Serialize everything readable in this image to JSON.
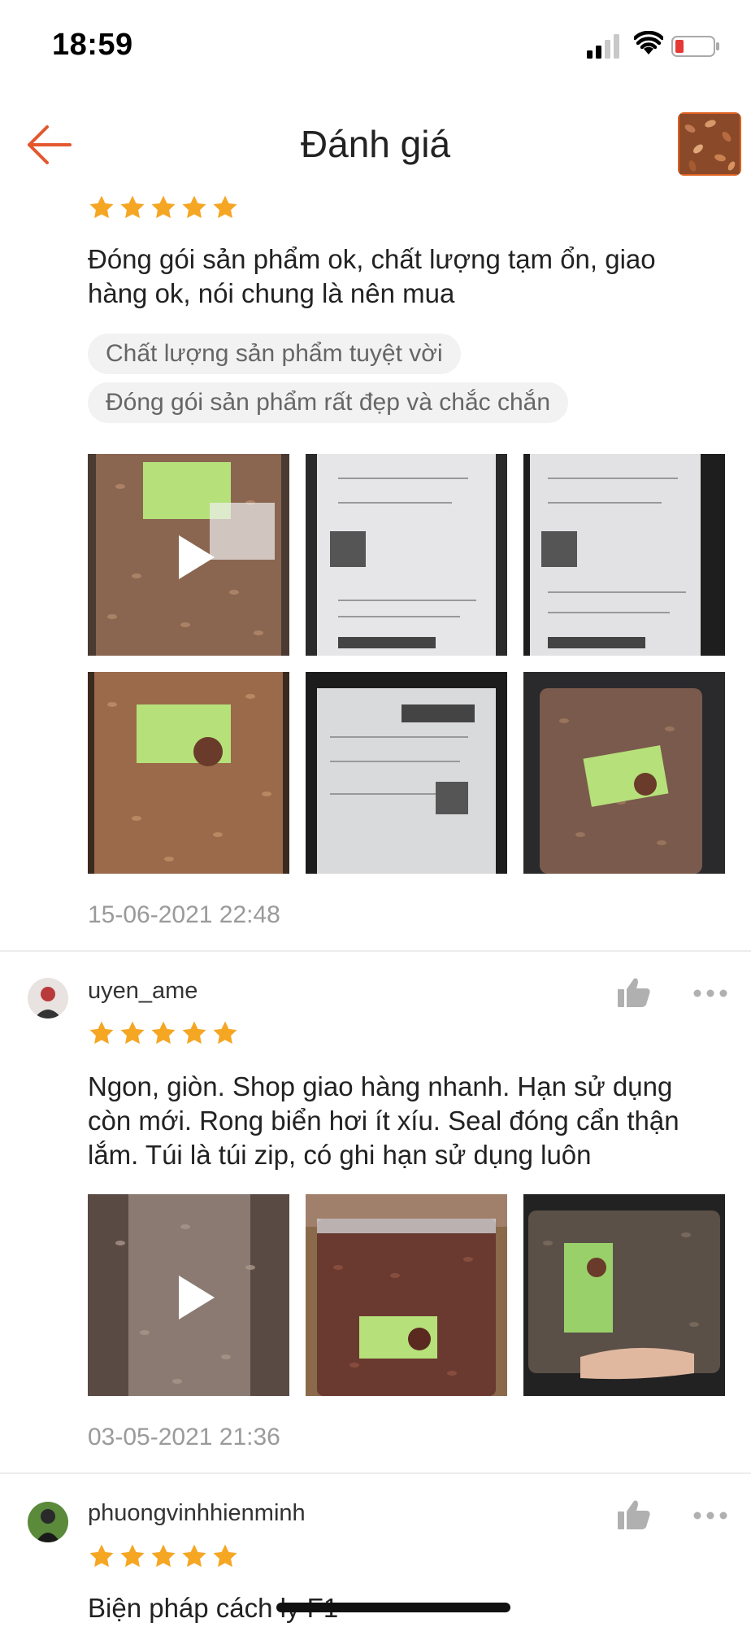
{
  "status_bar": {
    "time": "18:59"
  },
  "header": {
    "title": "Đánh giá"
  },
  "reviews": [
    {
      "rating": 5,
      "text": "Đóng gói sản phẩm ok, chất lượng tạm ổn, giao hàng ok, nói chung là nên mua",
      "tags": [
        "Chất lượng sản phẩm tuyệt vời",
        "Đóng gói sản phẩm rất đẹp và chắc chắn"
      ],
      "date": "15-06-2021 22:48"
    },
    {
      "username": "uyen_ame",
      "rating": 5,
      "text": "Ngon, giòn. Shop giao hàng nhanh. Hạn sử dụng còn mới. Rong biển hơi ít xíu. Seal đóng cẩn thận lắm. Túi là túi zip, có ghi hạn sử dụng luôn",
      "date": "03-05-2021 21:36"
    },
    {
      "username": "phuongvinhhienminh",
      "rating": 5,
      "text": "Biện pháp cách ly F1"
    }
  ]
}
